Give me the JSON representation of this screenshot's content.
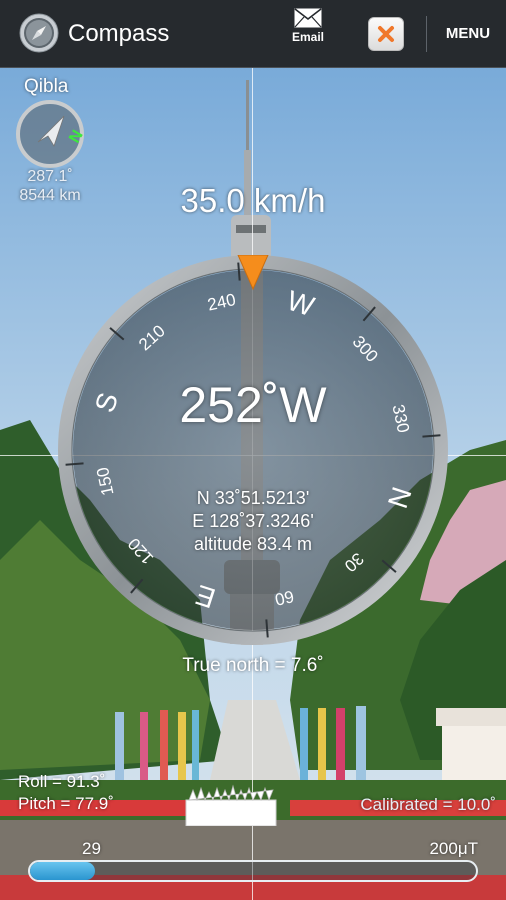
{
  "app": {
    "title": "Compass",
    "email_label": "Email",
    "menu_label": "MENU"
  },
  "qibla": {
    "title": "Qibla",
    "degrees": "287.1˚",
    "distance": "8544 km",
    "marker_letter": "N"
  },
  "speed": "35.0 km/h",
  "heading": {
    "value": "252˚W",
    "degrees": 252
  },
  "dial": {
    "cardinals": [
      "N",
      "E",
      "S",
      "W"
    ],
    "ticks": [
      "30",
      "60",
      "120",
      "150",
      "210",
      "240",
      "300",
      "330"
    ]
  },
  "location": {
    "latitude": "N 33˚51.5213'",
    "longitude": "E 128˚37.3246'",
    "altitude": "altitude 83.4 m"
  },
  "true_north": "True north = 7.6˚",
  "sensors": {
    "roll": "Roll   = 91.3˚",
    "pitch": "Pitch = 77.9˚",
    "calibrated": "Calibrated = 10.0˚"
  },
  "magnetic": {
    "current": "29",
    "max": "200μT",
    "fill_fraction": 0.145
  },
  "colors": {
    "action_bar": "#262a2e",
    "marker": "#f58d1c",
    "bar_fill": "#3aa3dc",
    "qibla_n": "#3de83d"
  },
  "icons": {
    "app": "compass-icon",
    "email": "envelope-icon",
    "close": "close-icon",
    "qibla": "qibla-arrow-icon"
  }
}
